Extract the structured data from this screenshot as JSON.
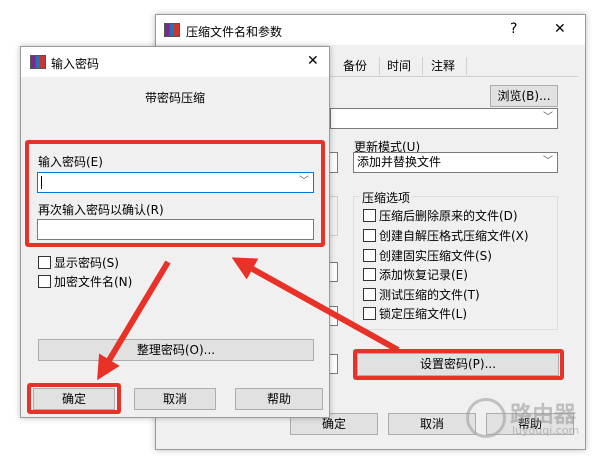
{
  "back_dialog": {
    "title": "压缩文件名和参数",
    "help_glyph": "?",
    "close_glyph": "✕",
    "tabs": [
      "备份",
      "时间",
      "注释"
    ],
    "browse_label": "浏览(B)...",
    "update_mode_label": "更新模式(U)",
    "update_mode_value": "添加并替换文件",
    "options_group_label": "压缩选项",
    "options": [
      "压缩后删除原来的文件(D)",
      "创建自解压格式压缩文件(X)",
      "创建固实压缩文件(S)",
      "添加恢复记录(E)",
      "测试压缩的文件(T)",
      "锁定压缩文件(L)"
    ],
    "set_password_label": "设置密码(P)...",
    "ok_label": "确定",
    "cancel_label": "取消",
    "help_label": "帮助"
  },
  "password_dialog": {
    "title": "输入密码",
    "close_glyph": "✕",
    "subtitle": "带密码压缩",
    "enter_label": "输入密码(E)",
    "confirm_label": "再次输入密码以确认(R)",
    "password_value": "",
    "confirm_value": "",
    "show_password_label": "显示密码(S)",
    "encrypt_names_label": "加密文件名(N)",
    "organize_label": "整理密码(O)...",
    "ok_label": "确定",
    "cancel_label": "取消",
    "help_label": "帮助"
  },
  "watermark": {
    "main": "路由器",
    "sub": "luyouqi.com"
  },
  "colors": {
    "highlight": "#e83227",
    "dialog_bg": "#f0f0f0",
    "focus_border": "#0078d7"
  }
}
